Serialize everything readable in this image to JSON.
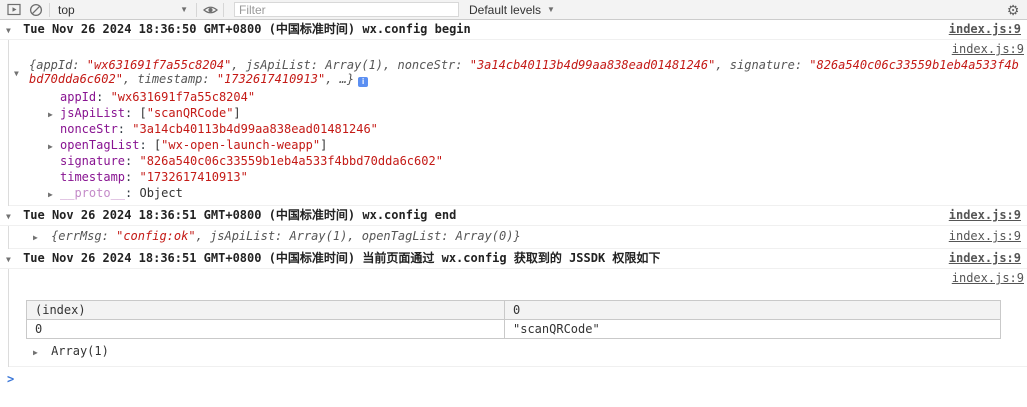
{
  "toolbar": {
    "frame_selector": "top",
    "filter_placeholder": "Filter",
    "levels_label": "Default levels",
    "caret": "▼"
  },
  "icons": {
    "tri_down": "▼",
    "tri_right": "▶",
    "info": "i",
    "gear": "⚙"
  },
  "colors": {
    "string_red": "#c41a16",
    "key_purple": "#881391",
    "link_grey": "#555555",
    "prompt_blue": "#3a76d8",
    "toolbar_bg": "#f3f3f3",
    "info_blue": "#5b8ff2"
  },
  "console": {
    "source_link": "index.js:9",
    "punct": {
      "colon": ": "
    },
    "prompt": ">",
    "group1": {
      "title": "Tue Nov 26 2024 18:36:50 GMT+0800 (中国标准时间) wx.config begin",
      "preview": [
        {
          "t": "{appId: "
        },
        {
          "t": "\"wx631691f7a55c8204\""
        },
        {
          "t": ", jsApiList: "
        },
        {
          "t": "Array(1)"
        },
        {
          "t": ", nonceStr: "
        },
        {
          "t": "\"3a14cb40113b4d99aa838ead01481246\""
        },
        {
          "t": ", signature: "
        },
        {
          "t": "\"826a540c06c33559b1eb4a533f4bbd70dda6c602\""
        },
        {
          "t": ", timestamp: "
        },
        {
          "t": "\"1732617410913\""
        },
        {
          "t": ", …}"
        }
      ],
      "props": [
        {
          "key": "appId",
          "segs": [
            {
              "t": "\"wx631691f7a55c8204\""
            }
          ]
        },
        {
          "key": "jsApiList",
          "segs": [
            {
              "t": "["
            },
            {
              "t": "\"scanQRCode\""
            },
            {
              "t": "]"
            }
          ]
        },
        {
          "key": "nonceStr",
          "segs": [
            {
              "t": "\"3a14cb40113b4d99aa838ead01481246\""
            }
          ]
        },
        {
          "key": "openTagList",
          "segs": [
            {
              "t": "["
            },
            {
              "t": "\"wx-open-launch-weapp\""
            },
            {
              "t": "]"
            }
          ]
        },
        {
          "key": "signature",
          "segs": [
            {
              "t": "\"826a540c06c33559b1eb4a533f4bbd70dda6c602\""
            }
          ]
        },
        {
          "key": "timestamp",
          "segs": [
            {
              "t": "\"1732617410913\""
            }
          ]
        },
        {
          "key": "__proto__",
          "segs": [
            {
              "t": "Object"
            }
          ]
        }
      ]
    },
    "group2": {
      "title": "Tue Nov 26 2024 18:36:51 GMT+0800 (中国标准时间) wx.config end",
      "preview": [
        {
          "t": "{errMsg: "
        },
        {
          "t": "\"config:ok\""
        },
        {
          "t": ", jsApiList: Array(1), openTagList: Array(0)}"
        }
      ]
    },
    "group3": {
      "title": "Tue Nov 26 2024 18:36:51 GMT+0800 (中国标准时间) 当前页面通过 wx.config 获取到的 JSSDK 权限如下",
      "table": {
        "col_index": "(index)",
        "col_0": "0",
        "cell_index": "0",
        "cell_value": "\"scanQRCode\""
      },
      "array_label": "Array(1)"
    }
  }
}
